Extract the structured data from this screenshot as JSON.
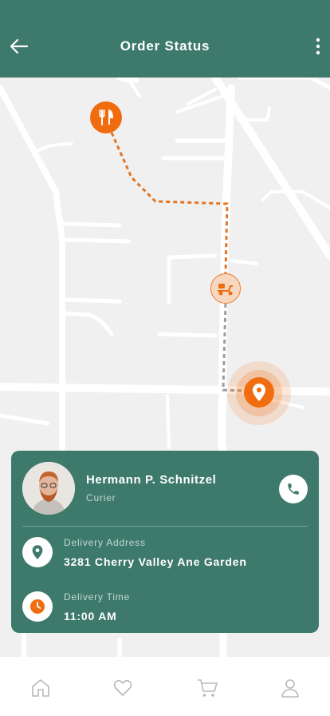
{
  "header": {
    "title": "Order Status",
    "back_icon": "arrow-left-icon",
    "menu_icon": "more-vertical-icon"
  },
  "map": {
    "restaurant_icon": "fork-knife-icon",
    "courier_icon": "scooter-icon",
    "destination_icon": "location-pin-icon"
  },
  "courier": {
    "name": "Hermann P. Schnitzel",
    "role": "Curier",
    "call_icon": "phone-icon"
  },
  "delivery": {
    "address_label": "Delivery Address",
    "address_value": "3281 Cherry Valley Ane Garden",
    "time_label": "Delivery Time",
    "time_value": "11:00 AM"
  },
  "bottom_nav": [
    {
      "name": "home",
      "icon": "home-icon"
    },
    {
      "name": "favorites",
      "icon": "heart-icon"
    },
    {
      "name": "cart",
      "icon": "cart-icon"
    },
    {
      "name": "profile",
      "icon": "user-icon"
    }
  ],
  "colors": {
    "primary": "#3e7a6c",
    "accent": "#f06c0f",
    "map_background": "#f0f0f1"
  }
}
